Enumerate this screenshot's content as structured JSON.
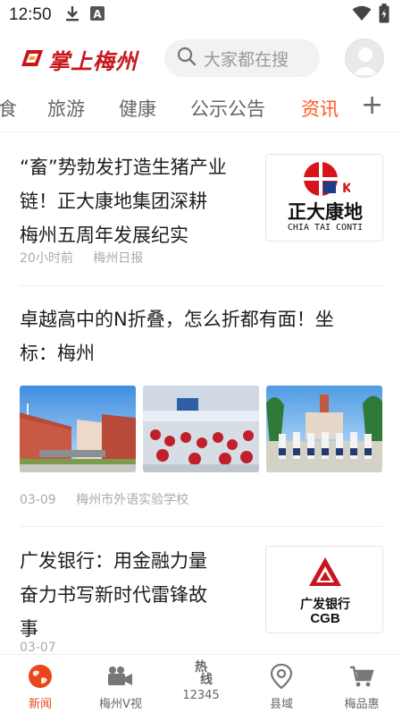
{
  "status_bar": {
    "time": "12:50",
    "icons": [
      "download-icon",
      "text-a-icon",
      "wifi-icon",
      "battery-charging-icon"
    ]
  },
  "header": {
    "logo_text": "掌上梅州",
    "search_placeholder": "大家都在搜",
    "search_icon": "search-icon",
    "avatar_icon": "user-avatar-icon"
  },
  "tabs": {
    "items": [
      {
        "label": "食"
      },
      {
        "label": "旅游"
      },
      {
        "label": "健康"
      },
      {
        "label": "公示公告"
      },
      {
        "label": "资讯"
      }
    ],
    "active_index": 4,
    "add_label": "+"
  },
  "articles": [
    {
      "title_lines": [
        "“畜”势勃发打造生猪产业",
        "链！正大康地集团深耕",
        "梅州五周年发展纪实"
      ],
      "time": "20小时前",
      "source": "梅州日报",
      "thumb": {
        "line1": "正大康地",
        "line2": "CHIA TAI CONTI"
      }
    },
    {
      "title_lines": [
        "卓越高中的N折叠，怎么折都有面！坐",
        "标：梅州"
      ],
      "time": "03-09",
      "source": "梅州市外语实验学校",
      "images": [
        "school-building-photo",
        "classroom-photo",
        "students-group-photo"
      ]
    },
    {
      "title_lines": [
        "广发银行：用金融力量",
        "奋力书写新时代雷锋故",
        "事"
      ],
      "time": "03-07",
      "source": "",
      "thumb": {
        "line1": "广发银行",
        "line2": "CGB"
      }
    }
  ],
  "bottom_nav": {
    "items": [
      {
        "label": "新闻",
        "icon": "globe-icon"
      },
      {
        "label": "梅州V视",
        "icon": "video-camera-icon"
      },
      {
        "label": "12345",
        "icon": "hotline-icon",
        "icon_text_1": "热",
        "icon_text_2": "线"
      },
      {
        "label": "县域",
        "icon": "location-pin-icon"
      },
      {
        "label": "梅品惠",
        "icon": "shopping-cart-icon"
      }
    ],
    "active_index": 0
  },
  "colors": {
    "accent": "#ff5a1f",
    "nav_active": "#e8461d",
    "brand_red": "#c8161d"
  }
}
